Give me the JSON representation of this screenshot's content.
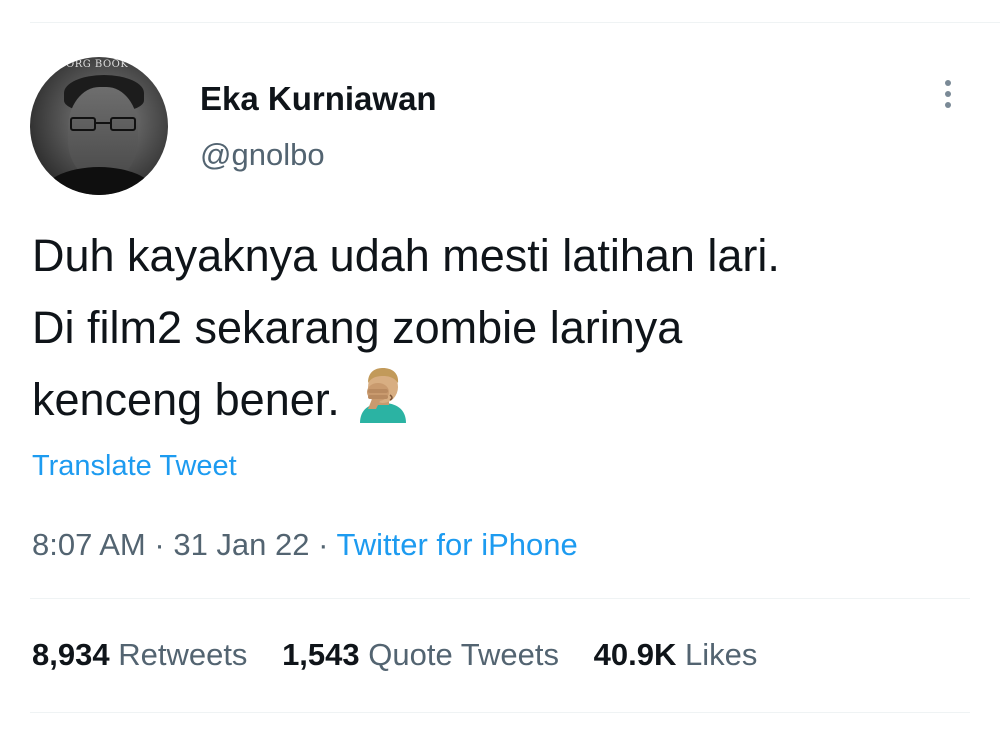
{
  "author": {
    "display_name": "Eka Kurniawan",
    "handle": "@gnolbo",
    "avatar_caption": "BORG BOOK"
  },
  "tweet": {
    "lines": [
      "Duh kayaknya udah mesti latihan lari.",
      "Di film2 sekarang zombie larinya",
      "kenceng bener."
    ],
    "emoji": "man-facepalming-emoji",
    "translate_label": "Translate Tweet"
  },
  "meta": {
    "time": "8:07 AM",
    "separator": "·",
    "date": "31 Jan 22",
    "source": "Twitter for iPhone"
  },
  "stats": {
    "retweets": {
      "count": "8,934",
      "label": "Retweets"
    },
    "quote_tweets": {
      "count": "1,543",
      "label": "Quote Tweets"
    },
    "likes": {
      "count": "40.9K",
      "label": "Likes"
    }
  },
  "icons": {
    "more": "more-vertical-icon"
  },
  "colors": {
    "link": "#1d9bf0",
    "secondary_text": "#536471",
    "primary_text": "#0f1419",
    "divider": "#eff3f4"
  }
}
